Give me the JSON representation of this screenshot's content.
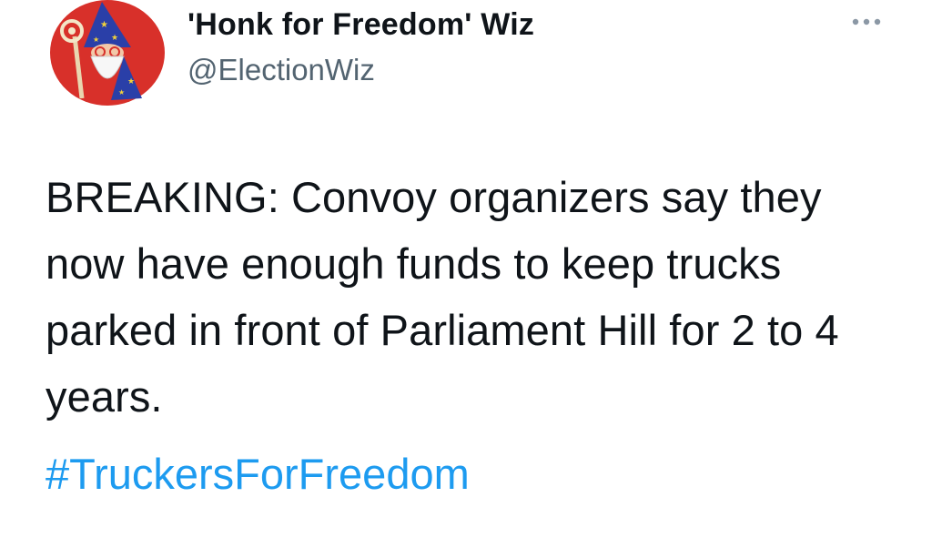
{
  "tweet": {
    "display_name": "'Honk for Freedom' Wiz",
    "handle": "@ElectionWiz",
    "text": "BREAKING: Convoy organizers say they now have enough funds to keep trucks parked in front of Parliament Hill for 2 to 4 years.",
    "hashtag": "#TruckersForFreedom",
    "avatar_icon": "wizard-avatar-icon",
    "more_icon": "more-options-icon"
  },
  "colors": {
    "text": "#0f1419",
    "handle": "#536471",
    "hashtag": "#1d9bf0",
    "avatar_bg": "#d8302a"
  }
}
